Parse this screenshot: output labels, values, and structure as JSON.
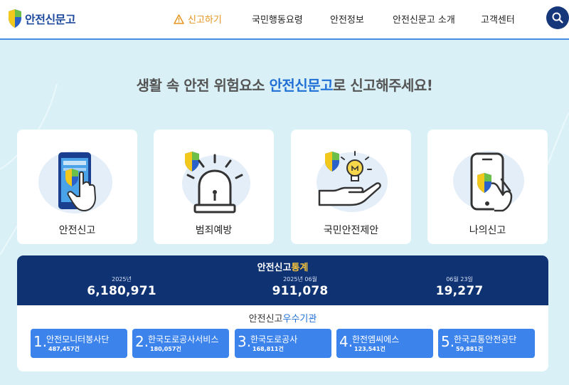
{
  "header": {
    "logo_text": "안전신문고",
    "nav": [
      {
        "label": "신고하기",
        "icon": "warning-icon",
        "active": true
      },
      {
        "label": "국민행동요령"
      },
      {
        "label": "안전정보"
      },
      {
        "label": "안전신문고 소개"
      },
      {
        "label": "고객센터"
      }
    ],
    "search_icon": "search-icon"
  },
  "headline": {
    "prefix": "생활 속 안전 위험요소 ",
    "brand": "안전신문고",
    "suffix": "로 신고해주세요!"
  },
  "cards": [
    {
      "label": "안전신고",
      "icon": "phone-tap-icon"
    },
    {
      "label": "범죄예방",
      "icon": "siren-icon"
    },
    {
      "label": "국민안전제안",
      "icon": "lightbulb-hand-icon"
    },
    {
      "label": "나의신고",
      "icon": "phone-shield-icon"
    }
  ],
  "stats": {
    "title_main": "안전신고",
    "title_accent": "통계",
    "items": [
      {
        "label": "2025년",
        "value": "6,180,971"
      },
      {
        "label": "2025년 06월",
        "value": "911,078"
      },
      {
        "label": "06월 23일",
        "value": "19,277"
      }
    ]
  },
  "orgs": {
    "title_main": "안전신고",
    "title_accent": "우수기관",
    "items": [
      {
        "rank": "1.",
        "name": "안전모니터봉사단",
        "count": "487,457건"
      },
      {
        "rank": "2.",
        "name": "한국도로공사서비스",
        "count": "180,057건"
      },
      {
        "rank": "3.",
        "name": "한국도로공사",
        "count": "168,811건"
      },
      {
        "rank": "4.",
        "name": "한전엠씨에스",
        "count": "123,541건"
      },
      {
        "rank": "5.",
        "name": "한국교통안전공단",
        "count": "59,881건"
      }
    ]
  },
  "colors": {
    "background": "#d9f1f6",
    "header_border": "#4a8ee3",
    "navy": "#0f3273",
    "brand_blue": "#1f6fd6",
    "accent_orange": "#e5941e",
    "accent_yellow": "#f6c33b",
    "org_blue": "#3c83ec"
  }
}
